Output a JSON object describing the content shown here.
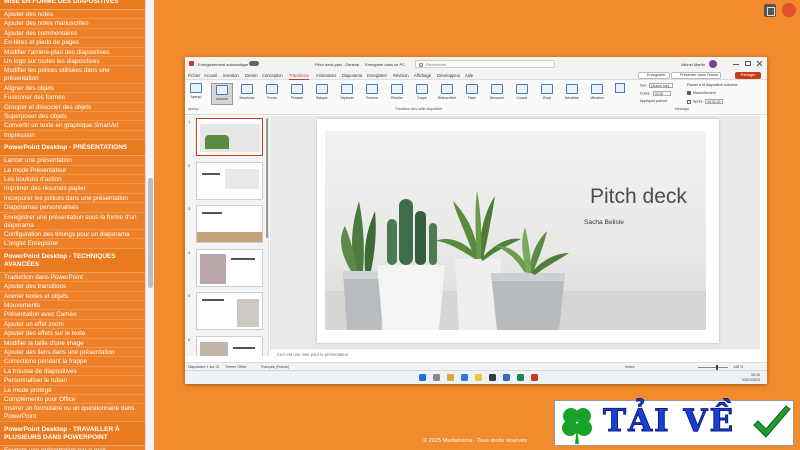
{
  "sidebar": {
    "sections": [
      {
        "title": "MISE EN FORME DES DIAPOSITIVES",
        "items": [
          "Ajouter des notes",
          "Ajouter des notes manuscrites",
          "Ajouter des commentaires",
          "En-têtes et pieds de pages",
          "Modifier l'arrière-plan des diapositives",
          "Un logo sur toutes les diapositives",
          "Modifier les polices utilisées dans une présentation",
          "Aligner des objets",
          "Fusionner des formes",
          "Grouper et dissocier des objets",
          "Superposer des objets",
          "Convertir un texte en graphique SmartArt",
          "Impression"
        ]
      },
      {
        "title": "PowerPoint Desktop - PRÉSENTATIONS",
        "items": [
          "Lancer une présentation",
          "Le mode Présentateur",
          "Les boutons d'action",
          "Imprimer des résumés papier",
          "Incorporer les polices dans une présentation",
          "Diaporamas personnalisés",
          "Enregistrer une présentation sous la forme d'un diaporama",
          "Configuration des timings pour un diaporama",
          "L'onglet Enregistrer"
        ]
      },
      {
        "title": "PowerPoint Desktop - TECHNIQUES AVANCÉES",
        "items": [
          "Traduction dans PowerPoint",
          "Ajouter des transitions",
          "Animer textes et objets",
          "Mouvements",
          "Présentation avec Caméo",
          "Ajouter un effet zoom",
          "Ajouter des effets sur le texte",
          "Modifier la taille d'une image",
          "Ajouter des liens dans une présentation",
          "Corrections pendant la frappe",
          "La trousse de diapositives",
          "Personnaliser le ruban",
          "Le mode protégé",
          "Compléments pour Office",
          "Insérer un formulaire ou un questionnaire dans PowerPoint"
        ]
      },
      {
        "title": "PowerPoint Desktop - TRAVAILLER À PLUSIEURS DANS POWERPOINT",
        "items": [
          "Envoyer une présentation par e-mail"
        ]
      }
    ]
  },
  "ppt": {
    "titlebar": {
      "autosave": "Enregistrement automatique",
      "filename": "Pitch deck.pptx",
      "sensitivity": "Général",
      "saved_state": "Enregistré dans ce PC",
      "search_placeholder": "Rechercher",
      "user": "Michel Martin"
    },
    "tabs": [
      "Fichier",
      "Accueil",
      "Insertion",
      "Dessin",
      "Conception",
      "Transitions",
      "Animations",
      "Diaporama",
      "Enregistrer",
      "Révision",
      "Affichage",
      "Développeur",
      "Aide"
    ],
    "active_tab": "Transitions",
    "record_label": "Enregistrer",
    "present_label": "Présenter dans Teams",
    "share_label": "Partager",
    "ribbon": {
      "preview_label": "Aperçu",
      "transitions": [
        "Aucune",
        "Morphose",
        "Fondu",
        "Pousser",
        "Balayer",
        "Déplacer",
        "Formes",
        "Révéler",
        "Coupe",
        "Rideau étiré",
        "Flash",
        "Découvrir",
        "Couvrir",
        "Éclat",
        "Actualiser",
        "Vibration"
      ],
      "selected_transition": "Aucune",
      "options_label": "Options d'effet",
      "group_preview": "Aperçu",
      "group_transitions": "Transition vers cette diapositive",
      "group_timing": "Minutage",
      "sound_label": "Son :",
      "sound_value": "[Aucun son]",
      "duration_label": "Durée :",
      "duration_value": "02,00",
      "apply_all": "Appliquer partout",
      "advance_label": "Passer à la diapositive suivante",
      "on_click": "Manuellement",
      "after_label": "Après :",
      "after_value": "00:00,00"
    },
    "slide": {
      "title": "Pitch deck",
      "subtitle": "Sacha Belisle"
    },
    "thumb_numbers": [
      "1",
      "2",
      "3",
      "4",
      "5",
      "6"
    ],
    "notes_placeholder": "Ceci est une note pour le présentateur",
    "status": {
      "slide_info": "Diapositive 1 sur 21",
      "theme": "Thème Office",
      "language": "Français (France)",
      "notes": "Notes",
      "zoom": "148 %"
    },
    "clock": {
      "time": "10:19",
      "date": "03/01/2024"
    }
  },
  "footer": "© 2025 Mediaforma · Tous droits réservés",
  "banner": {
    "text": "TẢI VỀ",
    "accent": "#1A3FD6",
    "check_color": "#1E9E2E",
    "clover_color": "#18A22B"
  },
  "colors": {
    "background": "#F28A2E",
    "ppt_accent": "#C43E1C"
  }
}
